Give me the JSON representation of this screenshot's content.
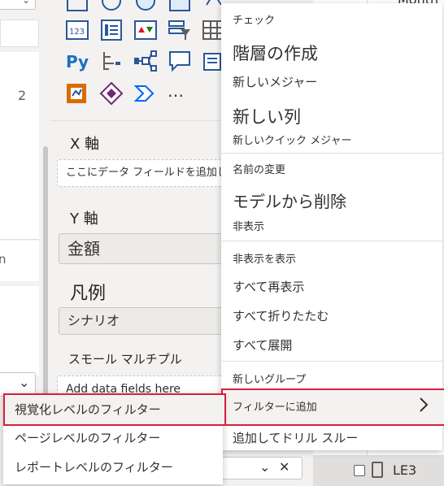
{
  "left_panel": {
    "number": "2",
    "partial_text": "n"
  },
  "viz_panel": {
    "icons": [
      "kpi-icon",
      "card-icon",
      "multirow-card-icon",
      "slicer-icon",
      "table-icon",
      "matrix-icon",
      "python-icon",
      "decomposition-tree-icon",
      "key-influencers-icon",
      "qa-icon",
      "smart-narrative-icon",
      "paginated-report-icon",
      "power-apps-icon",
      "power-automate-icon",
      "more-visuals-icon"
    ],
    "more_label": "…",
    "x_axis_title": "X 軸",
    "x_axis_placeholder": "ここにデータ フィールドを追加してください",
    "y_axis_title": "Y 軸",
    "y_axis_field": "金額",
    "legend_title": "凡例",
    "legend_field": "シナリオ",
    "small_multiples_title": "スモール マルチプル",
    "small_multiples_placeholder": "Add data fields here"
  },
  "right_panel": {
    "partial_header": "Month",
    "row_label": "LE3"
  },
  "context_menu": {
    "items": [
      {
        "label": "チェック"
      },
      {
        "label": "階層の作成"
      },
      {
        "label": "新しいメジャー"
      },
      {
        "label": "新しい列"
      },
      {
        "label": "新しいクイック メジャー"
      },
      {
        "label": "名前の変更"
      },
      {
        "label": "モデルから削除"
      },
      {
        "label": "非表示"
      },
      {
        "label": "非表示を表示"
      },
      {
        "label": "すべて再表示"
      },
      {
        "label": "すべて折りたたむ"
      },
      {
        "label": "すべて展開"
      },
      {
        "label": "新しいグループ"
      },
      {
        "label": "フィルターに追加"
      },
      {
        "label": "追加してドリル スルー"
      }
    ]
  },
  "submenu": {
    "items": [
      {
        "label": "視覚化レベルのフィルター"
      },
      {
        "label": "ページレベルのフィルター"
      },
      {
        "label": "レポートレベルのフィルター"
      }
    ]
  },
  "colors": {
    "highlight_border": "#d8203c",
    "menu_bg": "#ffffff",
    "panel_bg": "#f3f2f1"
  }
}
